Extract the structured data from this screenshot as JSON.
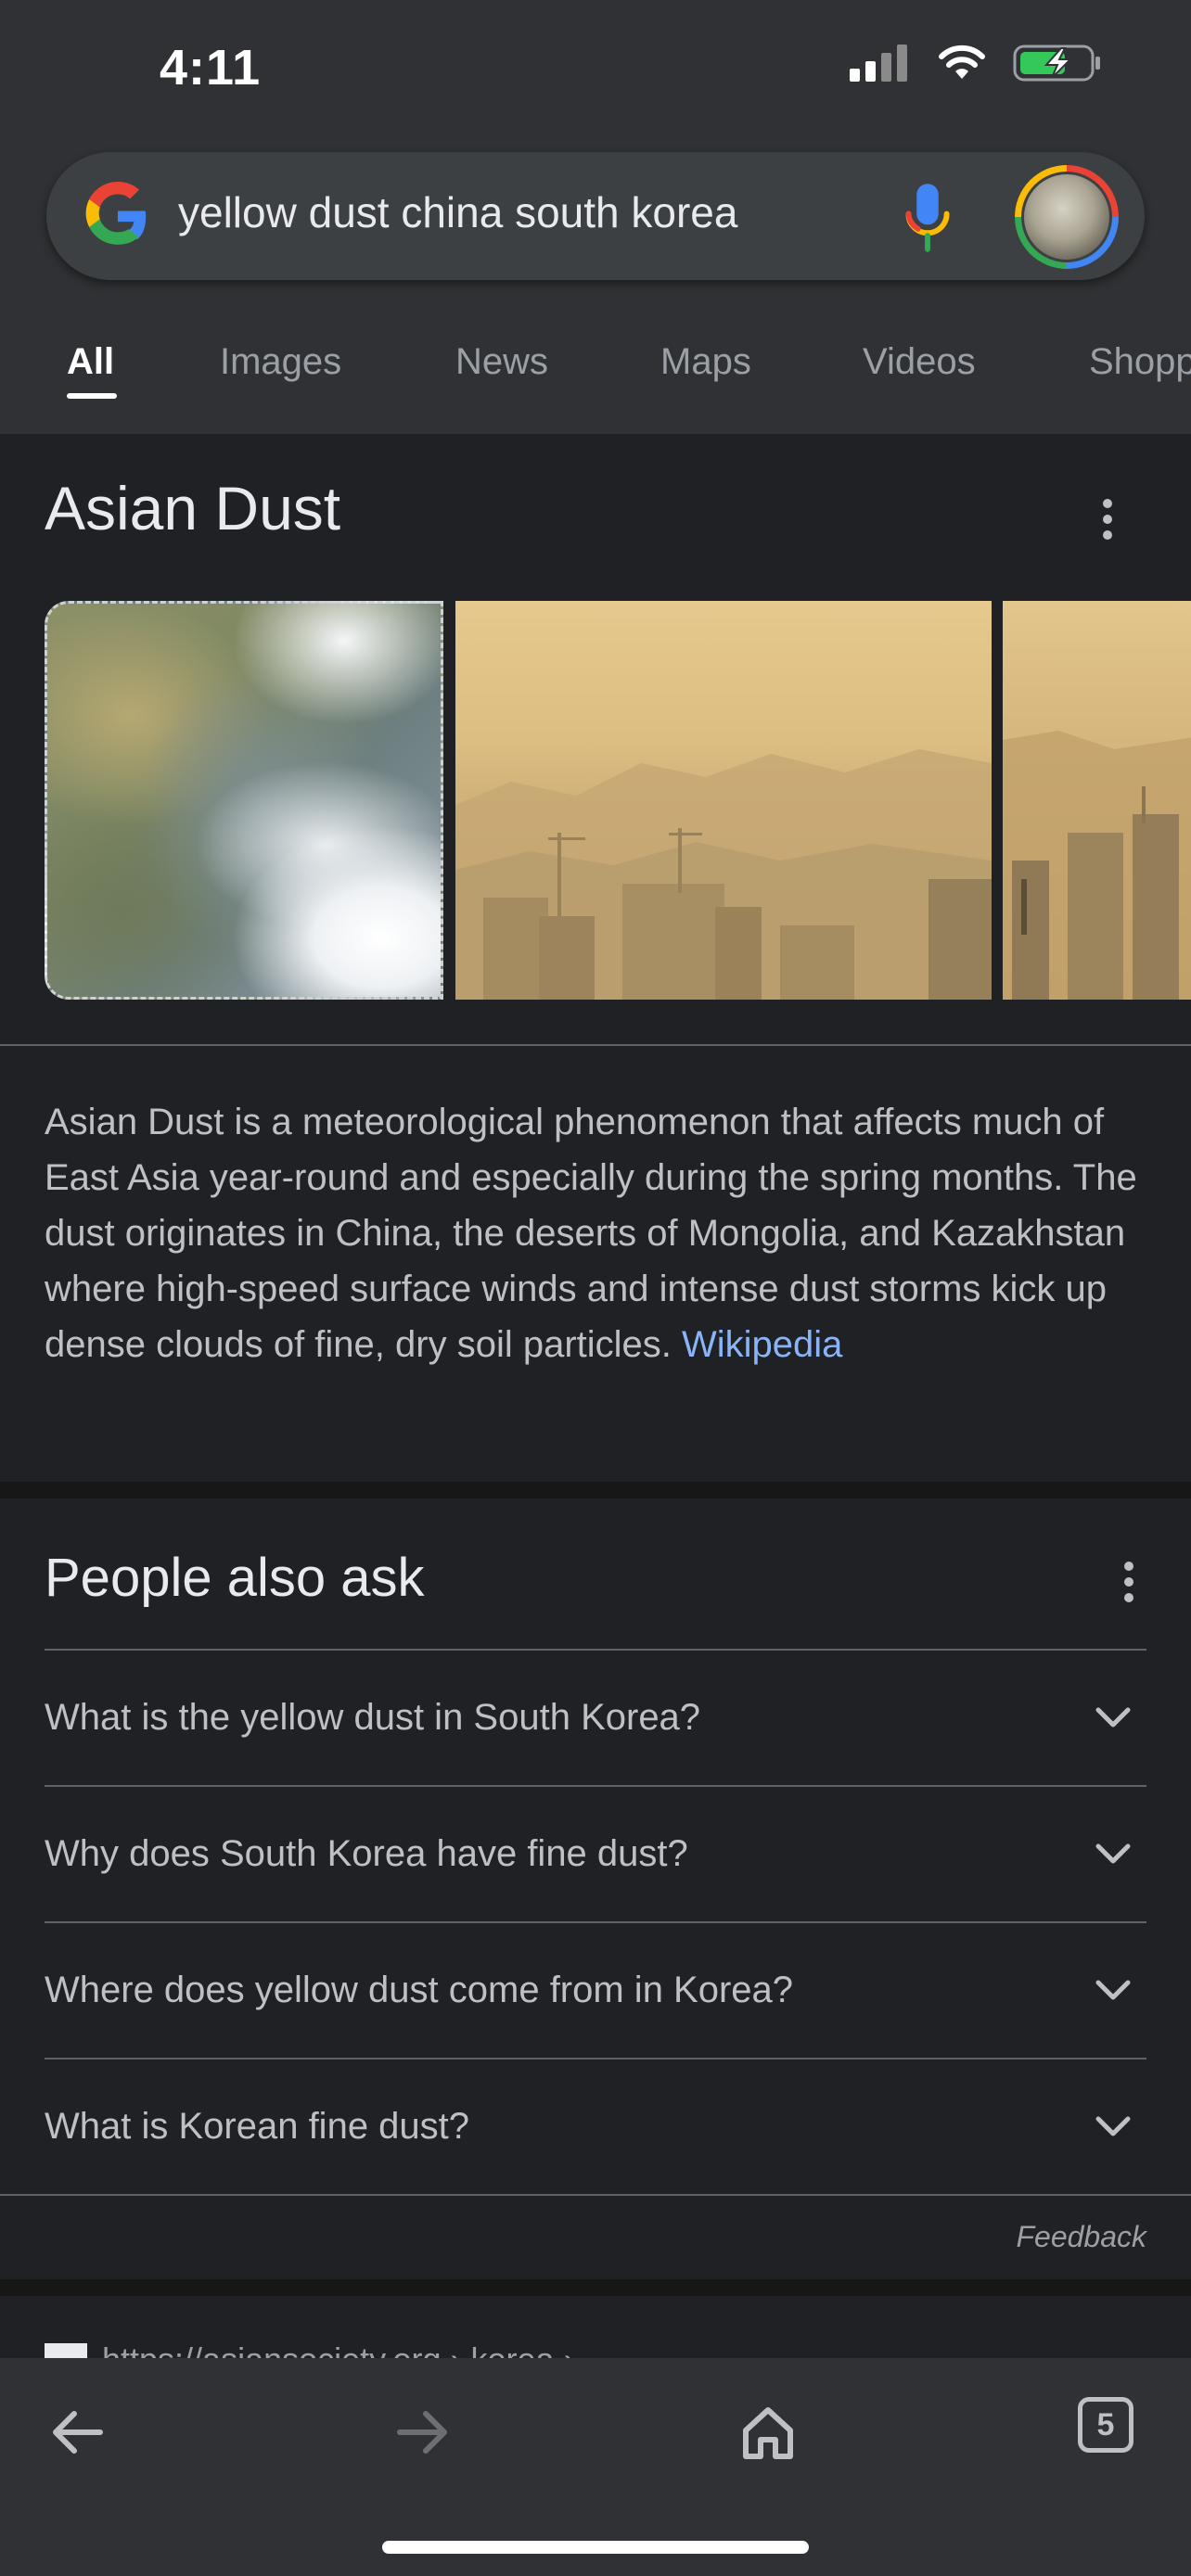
{
  "status_bar": {
    "time": "4:11"
  },
  "search": {
    "query": "yellow dust china south korea"
  },
  "tabs": [
    {
      "label": "All",
      "active": true
    },
    {
      "label": "Images"
    },
    {
      "label": "News"
    },
    {
      "label": "Maps"
    },
    {
      "label": "Videos"
    },
    {
      "label": "Shopp"
    }
  ],
  "knowledge_panel": {
    "title": "Asian Dust",
    "description": "Asian Dust is a meteorological phenomenon that affects much of East Asia year-round and especially during the spring months. The dust originates in China, the deserts of Mongolia, and Kazakhstan where high-speed surface winds and intense dust storms kick up dense clouds of fine, dry soil particles.",
    "source_link": "Wikipedia"
  },
  "people_also_ask": {
    "title": "People also ask",
    "questions": [
      "What is the yellow dust in South Korea?",
      "Why does South Korea have fine dust?",
      "Where does yellow dust come from in Korea?",
      "What is Korean fine dust?"
    ],
    "feedback": "Feedback"
  },
  "next_result": {
    "url_peek": "https://asiansociety.org › korea › ..."
  },
  "bottom_nav": {
    "tab_count": "5"
  },
  "colors": {
    "background": "#202124",
    "toolbar": "#303134",
    "link": "#8ab4f8",
    "text_primary": "#e8eaed",
    "text_secondary": "#bdc1c6"
  }
}
